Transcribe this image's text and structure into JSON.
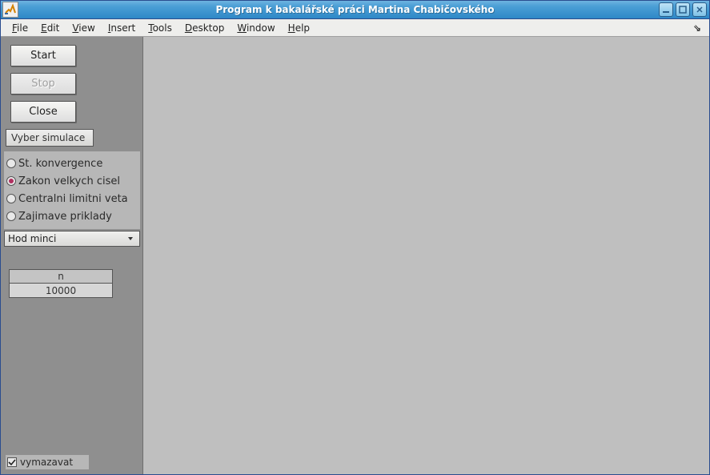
{
  "window": {
    "title": "Program k bakalářské práci Martina Chabičovského"
  },
  "menubar": {
    "items": [
      {
        "label": "File",
        "accel": "F"
      },
      {
        "label": "Edit",
        "accel": "E"
      },
      {
        "label": "View",
        "accel": "V"
      },
      {
        "label": "Insert",
        "accel": "I"
      },
      {
        "label": "Tools",
        "accel": "T"
      },
      {
        "label": "Desktop",
        "accel": "D"
      },
      {
        "label": "Window",
        "accel": "W"
      },
      {
        "label": "Help",
        "accel": "H"
      }
    ]
  },
  "sidebar": {
    "buttons": {
      "start": "Start",
      "stop": "Stop",
      "close": "Close"
    },
    "select_sim_label": "Vyber simulace",
    "radios": [
      {
        "label": "St. konvergence",
        "selected": false
      },
      {
        "label": "Zakon velkych cisel",
        "selected": true
      },
      {
        "label": "Centralni limitni veta",
        "selected": false
      },
      {
        "label": "Zajimave priklady",
        "selected": false
      }
    ],
    "dropdown": {
      "selected": "Hod minci"
    },
    "param": {
      "name": "n",
      "value": "10000"
    },
    "clear_checkbox": {
      "label": "vymazavat",
      "checked": true
    }
  }
}
